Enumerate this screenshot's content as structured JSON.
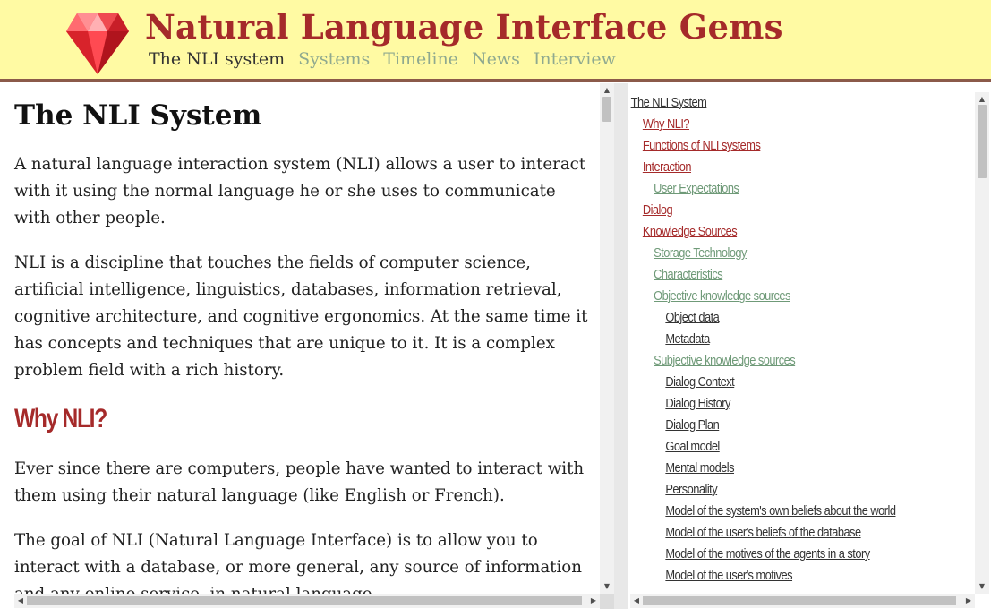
{
  "header": {
    "title": "Natural Language Interface Gems",
    "nav": [
      {
        "label": "The NLI system",
        "active": true
      },
      {
        "label": "Systems",
        "active": false
      },
      {
        "label": "Timeline",
        "active": false
      },
      {
        "label": "News",
        "active": false
      },
      {
        "label": "Interview",
        "active": false
      }
    ]
  },
  "content": {
    "title": "The NLI System",
    "intro": [
      "A natural language interaction system (NLI) allows a user to interact with it using the normal language he or she uses to communicate with other people.",
      "NLI is a discipline that touches the fields of computer science, artificial intelligence, linguistics, databases, information retrieval, cognitive architecture, and cognitive ergonomics. At the same time it has concepts and techniques that are unique to it. It is a complex problem field with a rich history."
    ],
    "section_heading": "Why NLI?",
    "section_paragraphs": [
      "Ever since there are computers, people have wanted to interact with them using their natural language (like English or French).",
      "The goal of NLI (Natural Language Interface) is to allow you to interact with a database, or more general, any source of information and any online service, in natural language."
    ]
  },
  "toc": {
    "items": [
      {
        "label": "The NLI System",
        "level": 0
      },
      {
        "label": "Why NLI?",
        "level": 1
      },
      {
        "label": "Functions of NLI systems",
        "level": 1
      },
      {
        "label": "Interaction",
        "level": 1
      },
      {
        "label": "User Expectations",
        "level": 2
      },
      {
        "label": "Dialog",
        "level": 1
      },
      {
        "label": "Knowledge Sources",
        "level": 1
      },
      {
        "label": "Storage Technology",
        "level": 2
      },
      {
        "label": "Characteristics",
        "level": 2
      },
      {
        "label": "Objective knowledge sources",
        "level": 2
      },
      {
        "label": "Object data",
        "level": 3
      },
      {
        "label": "Metadata",
        "level": 3
      },
      {
        "label": "Subjective knowledge sources",
        "level": 2
      },
      {
        "label": "Dialog Context",
        "level": 3
      },
      {
        "label": "Dialog History",
        "level": 3
      },
      {
        "label": "Dialog Plan",
        "level": 3
      },
      {
        "label": "Goal model",
        "level": 3
      },
      {
        "label": "Mental models",
        "level": 3
      },
      {
        "label": "Personality",
        "level": 3
      },
      {
        "label": "Model of the system's own beliefs about the world",
        "level": 3
      },
      {
        "label": "Model of the user's beliefs of the database",
        "level": 3
      },
      {
        "label": "Model of the motives of the agents in a story",
        "level": 3
      },
      {
        "label": "Model of the user's motives",
        "level": 3
      }
    ]
  },
  "icons": {
    "logo": "ruby-gem-icon",
    "scroll_up": "triangle-up-icon",
    "scroll_down": "triangle-down-icon",
    "scroll_left": "triangle-left-icon",
    "scroll_right": "triangle-right-icon"
  },
  "colors": {
    "header_bg": "#fffaa3",
    "brand": "#a52a2a",
    "nav_inactive": "#8fa98f",
    "toc_level2": "#6f9a78"
  }
}
